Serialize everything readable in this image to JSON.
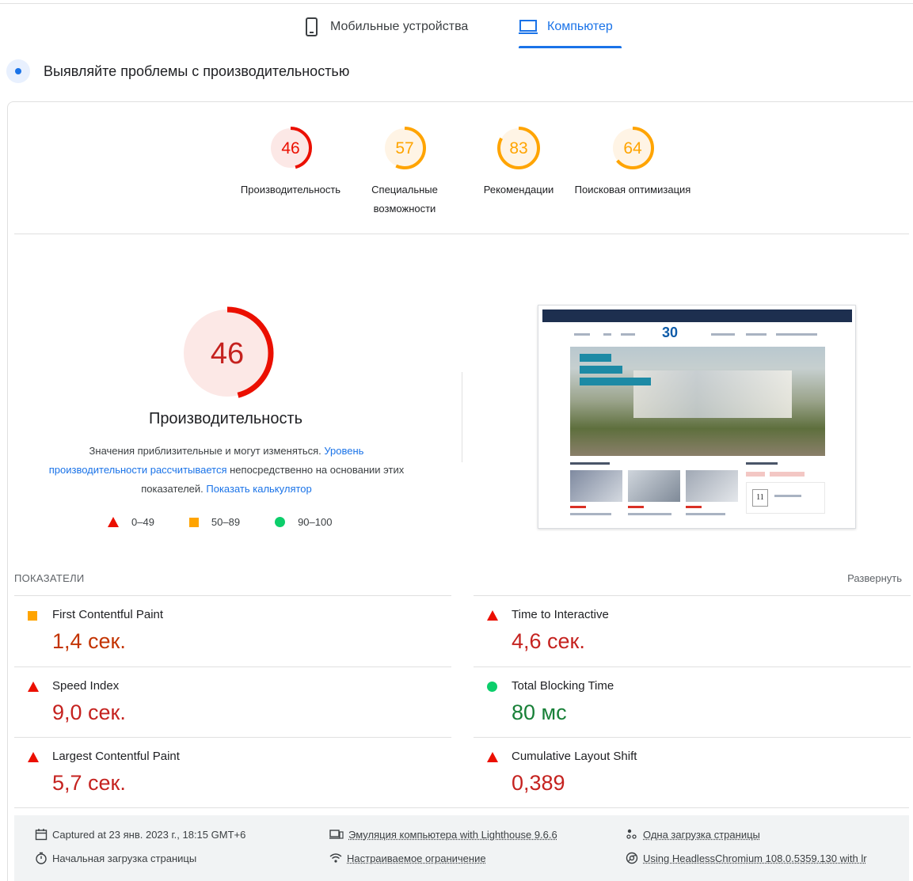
{
  "tabs": {
    "mobile": "Мобильные устройства",
    "desktop": "Компьютер"
  },
  "header": {
    "title": "Выявляйте проблемы с производительностью"
  },
  "scores": [
    {
      "value": "46",
      "label": "Производительность",
      "color": "#eb0f00",
      "fill": 0.46,
      "bg": "#fce8e6"
    },
    {
      "value": "57",
      "label": "Специальные возможности",
      "color": "#ffa400",
      "fill": 0.57,
      "bg": "#fff4e5"
    },
    {
      "value": "83",
      "label": "Рекомендации",
      "color": "#ffa400",
      "fill": 0.83,
      "bg": "#fff4e5"
    },
    {
      "value": "64",
      "label": "Поисковая оптимизация",
      "color": "#ffa400",
      "fill": 0.64,
      "bg": "#fff4e5"
    }
  ],
  "performance": {
    "score": "46",
    "fill": 0.46,
    "title": "Производительность",
    "note_1": "Значения приблизительные и могут изменяться. ",
    "note_link1": "Уровень производительности рассчитывается",
    "note_2": " непосредственно на основании этих показателей. ",
    "note_link2": "Показать калькулятор"
  },
  "legend": [
    {
      "shape": "triangle",
      "range": "0–49"
    },
    {
      "shape": "square",
      "range": "50–89"
    },
    {
      "shape": "circle",
      "range": "90–100"
    }
  ],
  "thumbnail": {
    "logo_text": "30",
    "calendar_day": "11"
  },
  "metrics_header": {
    "title": "ПОКАЗАТЕЛИ",
    "expand": "Развернуть"
  },
  "metrics": [
    {
      "name": "First Contentful Paint",
      "value": "1,4 сек.",
      "status": "average",
      "color": "#c33300"
    },
    {
      "name": "Time to Interactive",
      "value": "4,6 сек.",
      "status": "fail",
      "color": "#c5221f"
    },
    {
      "name": "Speed Index",
      "value": "9,0 сек.",
      "status": "fail",
      "color": "#c5221f"
    },
    {
      "name": "Total Blocking Time",
      "value": "80 мс",
      "status": "pass",
      "color": "#188038"
    },
    {
      "name": "Largest Contentful Paint",
      "value": "5,7 сек.",
      "status": "fail",
      "color": "#c5221f"
    },
    {
      "name": "Cumulative Layout Shift",
      "value": "0,389",
      "status": "fail",
      "color": "#c5221f"
    }
  ],
  "footer": {
    "captured": "Captured at 23 янв. 2023 г., 18:15 GMT+6",
    "initial_load": "Начальная загрузка страницы",
    "emulation": "Эмуляция компьютера with Lighthouse 9.6.6",
    "throttling": "Настраиваемое ограничение",
    "single_load": "Одна загрузка страницы",
    "browser": "Using HeadlessChromium 108.0.5359.130 with lr"
  },
  "colors": {
    "accent": "#1a73e8",
    "fail": "#eb0f00",
    "average": "#ffa400",
    "pass": "#0cce6b"
  }
}
